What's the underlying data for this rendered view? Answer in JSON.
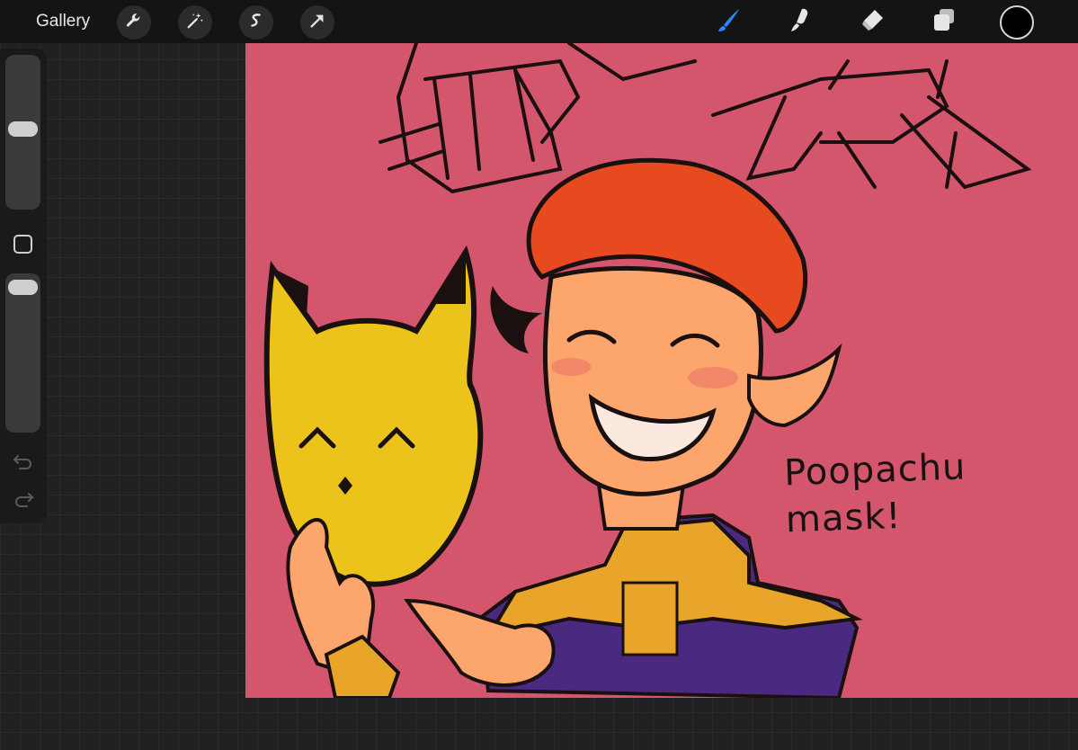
{
  "toolbar": {
    "gallery_label": "Gallery",
    "left_tools": [
      "wrench-icon",
      "magic-wand-icon",
      "selection-icon",
      "transform-arrow-icon"
    ],
    "right_tools": [
      "brush-icon",
      "smudge-icon",
      "eraser-icon",
      "layers-icon"
    ],
    "active_tool": "brush-icon",
    "active_color": "#000000",
    "brush_accent": "#2a84ff"
  },
  "sidebar": {
    "brush_size_level": 0.55,
    "opacity_level": 0.05,
    "controls": [
      "modify-button",
      "undo-icon",
      "redo-icon"
    ]
  },
  "canvas": {
    "background_color": "#d4566d",
    "caption_line1": "Poopachu",
    "caption_line2": "mask!"
  }
}
